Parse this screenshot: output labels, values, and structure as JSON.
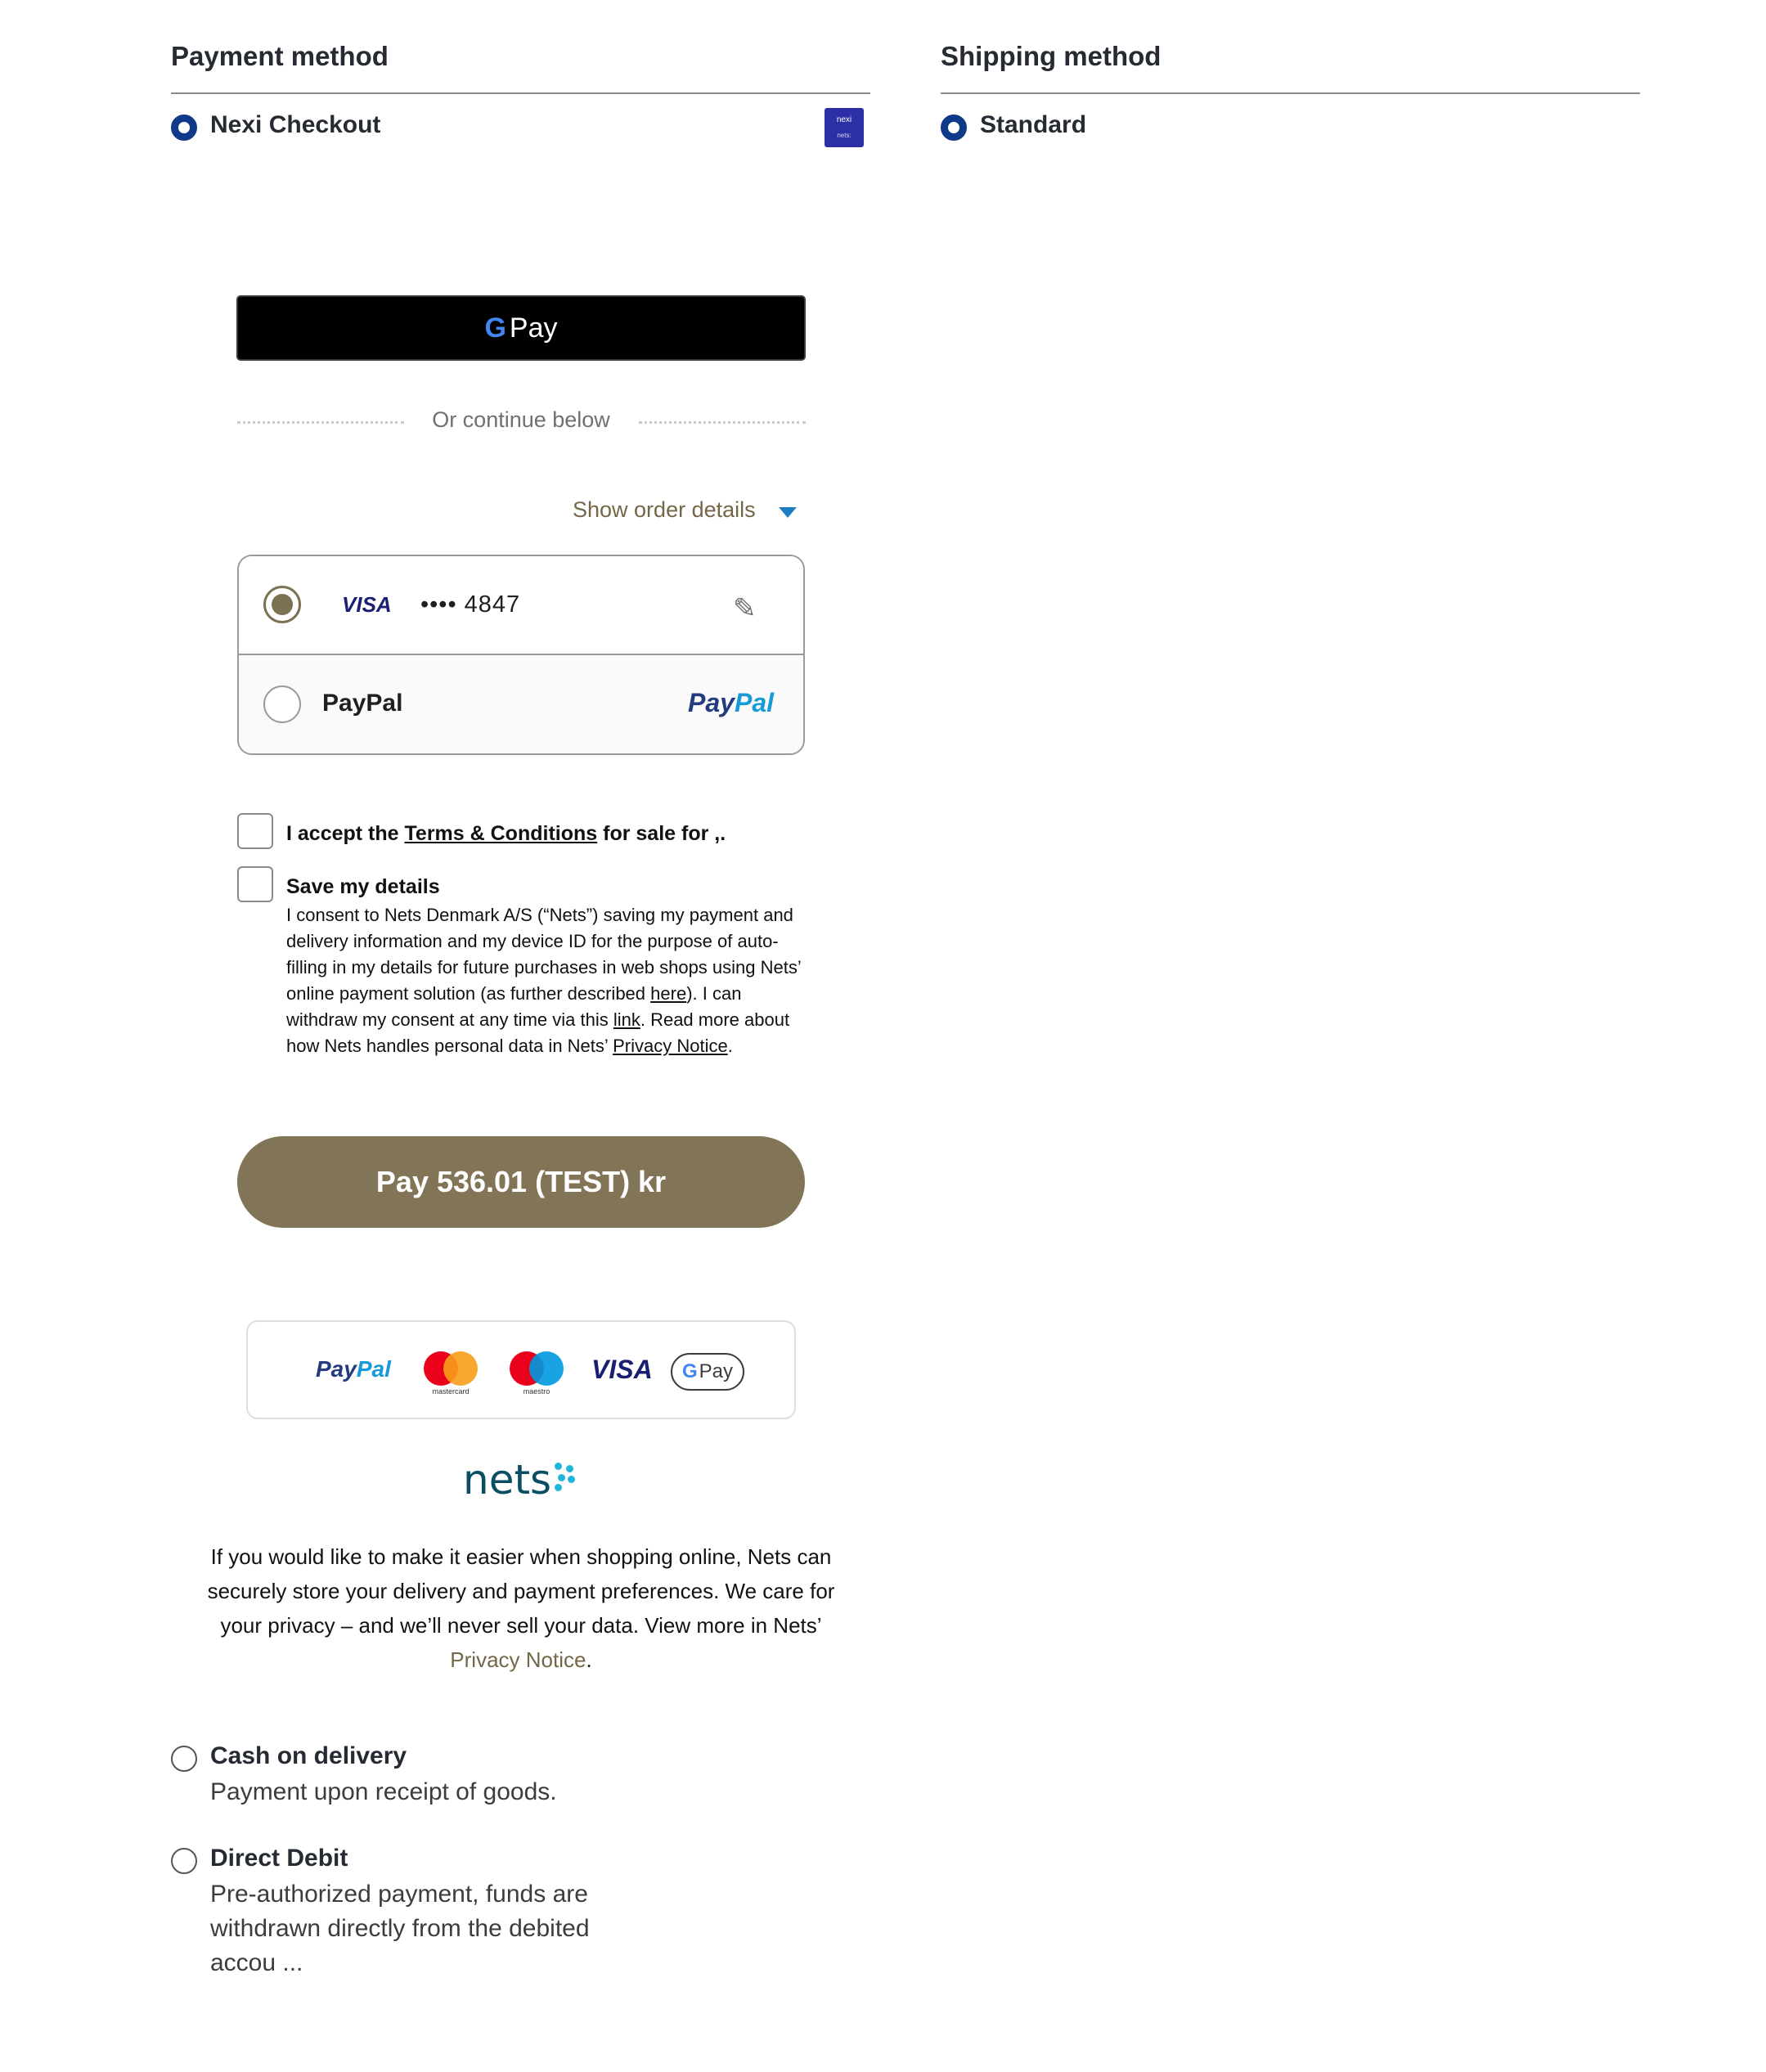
{
  "payment": {
    "title": "Payment method",
    "nexi": {
      "label": "Nexi Checkout",
      "logo_line1": "nexi",
      "logo_line2": "nets:"
    },
    "checkout": {
      "gpay_label": "Pay",
      "divider_text": "Or continue below",
      "order_details": "Show order details",
      "card": {
        "brand": "VISA",
        "number": "•••• 4847"
      },
      "paypal_label": "PayPal",
      "paypal_logo_a": "Pay",
      "paypal_logo_b": "Pal",
      "terms_prefix": "I accept the ",
      "terms_link": "Terms & Conditions",
      "terms_suffix": " for sale for ,.",
      "save_title": "Save my details",
      "save_body_1": "I consent to Nets Denmark A/S (“Nets”) saving my payment and delivery information and my device ID for the purpose of auto-filling in my details for future purchases in web shops using Nets’ online payment solution (as further described ",
      "save_link_here": "here",
      "save_body_2": "). I can withdraw my consent at any time via this ",
      "save_link_link": "link",
      "save_body_3": ". Read more about how Nets handles personal data in Nets’ ",
      "save_link_privacy": "Privacy Notice",
      "save_body_4": ".",
      "pay_button": "Pay 536.01 (TEST) kr",
      "brands": {
        "paypal_a": "Pay",
        "paypal_b": "Pal",
        "mastercard": "mastercard",
        "maestro": "maestro",
        "visa": "VISA",
        "gpay": "Pay"
      },
      "nets_logo": "nets",
      "nets_info": "If you would like to make it easier when shopping online, Nets can securely store your delivery and payment preferences. We care for your privacy – and we’ll never sell your data. View more in Nets’ ",
      "nets_info_link": "Privacy Notice",
      "nets_info_end": "."
    },
    "cod": {
      "label": "Cash on delivery",
      "desc": "Payment upon receipt of goods."
    },
    "dd": {
      "label": "Direct Debit",
      "desc": "Pre-authorized payment, funds are withdrawn directly from the debited accou ..."
    }
  },
  "shipping": {
    "title": "Shipping method",
    "standard": {
      "label": "Standard"
    }
  },
  "colors": {
    "radio_selected": "#0f3a8a",
    "pay_button": "#827456",
    "link_brown": "#746647",
    "caret_blue": "#1f7ec1"
  }
}
